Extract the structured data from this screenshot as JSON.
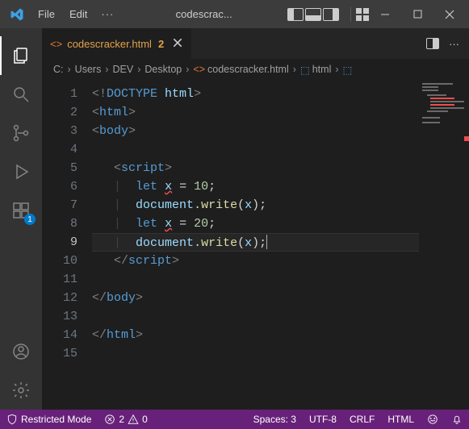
{
  "titlebar": {
    "menu": {
      "file": "File",
      "edit": "Edit",
      "more": "···"
    },
    "title": "codescrac..."
  },
  "activity": {
    "extensions_badge": "1"
  },
  "tab": {
    "filename": "codescracker.html",
    "modified_indicator": "2",
    "more": "···"
  },
  "breadcrumbs": {
    "sep": "›",
    "parts": [
      "C:",
      "Users",
      "DEV",
      "Desktop"
    ],
    "file": "codescracker.html",
    "symbols": [
      "html"
    ]
  },
  "code": {
    "lines": [
      {
        "n": "1",
        "indent": "",
        "html": "<span class='p-gray'>&lt;!</span><span class='p-doctype'>DOCTYPE</span> <span class='p-var'>html</span><span class='p-gray'>&gt;</span>"
      },
      {
        "n": "2",
        "indent": "",
        "html": "<span class='p-gray'>&lt;</span><span class='p-tag'>html</span><span class='p-gray'>&gt;</span>"
      },
      {
        "n": "3",
        "indent": "",
        "html": "<span class='p-gray'>&lt;</span><span class='p-tag'>body</span><span class='p-gray'>&gt;</span>"
      },
      {
        "n": "4",
        "indent": "",
        "html": ""
      },
      {
        "n": "5",
        "indent": "   ",
        "html": "<span class='p-gray'>&lt;</span><span class='p-tag'>script</span><span class='p-gray'>&gt;</span>"
      },
      {
        "n": "6",
        "indent": "   <span class='indent'>|</span>  ",
        "html": "<span class='p-kw'>let</span> <span class='p-var err'>x</span> <span class='p-op'>=</span> <span class='p-num'>10</span><span class='p-punc'>;</span>"
      },
      {
        "n": "7",
        "indent": "   <span class='indent'>|</span>  ",
        "html": "<span class='p-obj'>document</span><span class='p-punc'>.</span><span class='p-fn'>write</span><span class='p-punc'>(</span><span class='p-var'>x</span><span class='p-punc'>);</span>"
      },
      {
        "n": "8",
        "indent": "   <span class='indent'>|</span>  ",
        "html": "<span class='p-kw'>let</span> <span class='p-var err'>x</span> <span class='p-op'>=</span> <span class='p-num'>20</span><span class='p-punc'>;</span>"
      },
      {
        "n": "9",
        "indent": "   <span class='indent'>|</span>  ",
        "html": "<span class='p-obj'>document</span><span class='p-punc'>.</span><span class='p-fn'>write</span><span class='p-punc'>(</span><span class='p-var'>x</span><span class='p-punc'>);</span><span class='cursor'></span>",
        "current": true
      },
      {
        "n": "10",
        "indent": "   ",
        "html": "<span class='p-gray'>&lt;/</span><span class='p-tag'>script</span><span class='p-gray'>&gt;</span>"
      },
      {
        "n": "11",
        "indent": "",
        "html": ""
      },
      {
        "n": "12",
        "indent": "",
        "html": "<span class='p-gray'>&lt;/</span><span class='p-tag'>body</span><span class='p-gray'>&gt;</span>"
      },
      {
        "n": "13",
        "indent": "",
        "html": ""
      },
      {
        "n": "14",
        "indent": "",
        "html": "<span class='p-gray'>&lt;/</span><span class='p-tag'>html</span><span class='p-gray'>&gt;</span>"
      },
      {
        "n": "15",
        "indent": "",
        "html": ""
      }
    ]
  },
  "statusbar": {
    "restricted": "Restricted Mode",
    "errors": "2",
    "warnings": "0",
    "spaces": "Spaces: 3",
    "encoding": "UTF-8",
    "eol": "CRLF",
    "lang": "HTML"
  }
}
